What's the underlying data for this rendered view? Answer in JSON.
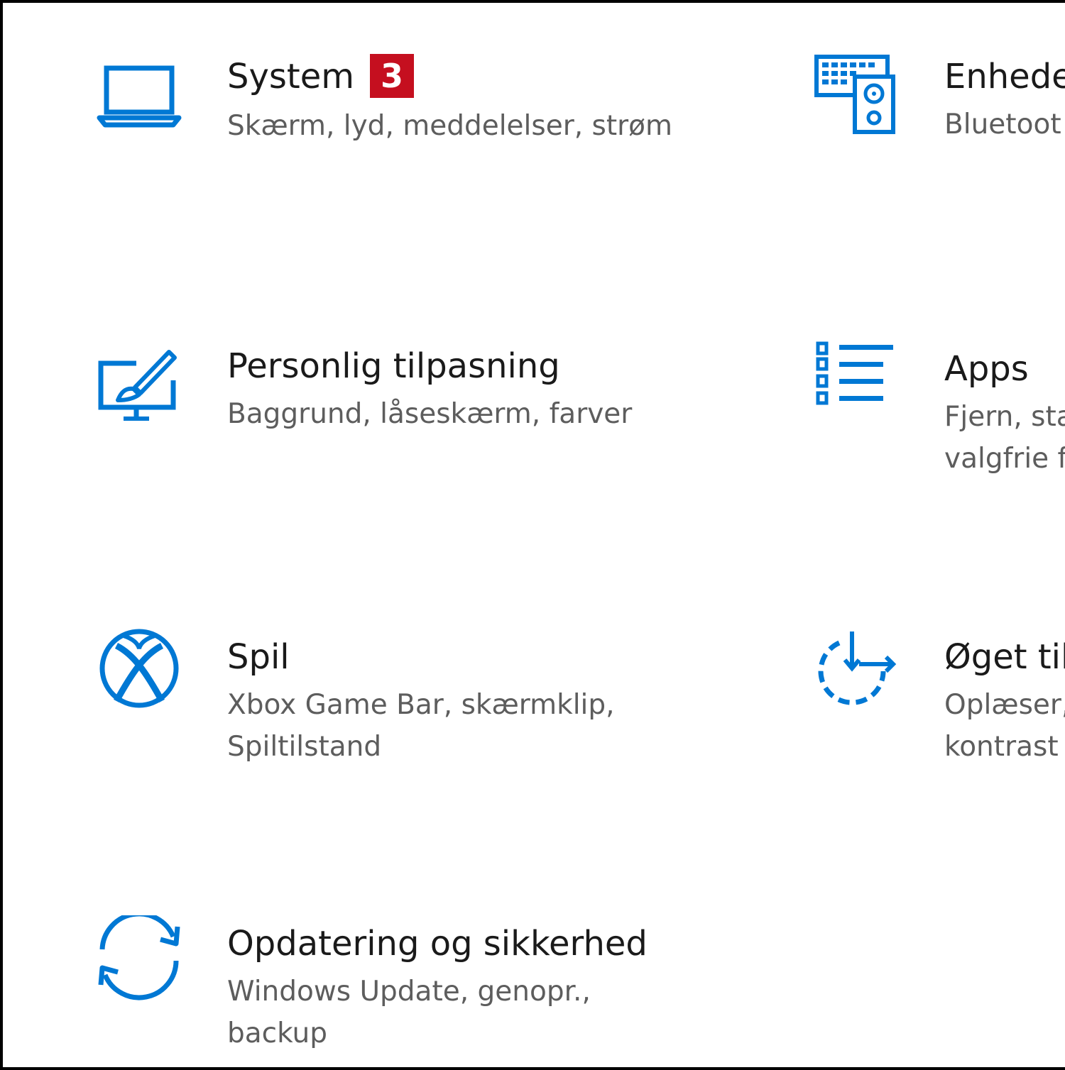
{
  "accent_color": "#0078d4",
  "badge_color": "#c50f1f",
  "tiles": [
    {
      "icon": "laptop-icon",
      "title": "System",
      "badge": "3",
      "desc_line1": "Skærm, lyd, meddelelser, strøm",
      "desc_line2": ""
    },
    {
      "icon": "keyboard-speaker-icon",
      "title": "Enhede",
      "desc_line1": "Bluetoot",
      "desc_line2": ""
    },
    {
      "icon": "monitor-paintbrush-icon",
      "title": "Personlig tilpasning",
      "desc_line1": "Baggrund, låseskærm, farver",
      "desc_line2": ""
    },
    {
      "icon": "apps-list-icon",
      "title": "Apps",
      "desc_line1": "Fjern, sta",
      "desc_line2": "valgfrie f"
    },
    {
      "icon": "xbox-icon",
      "title": "Spil",
      "desc_line1": "Xbox Game Bar, skærmklip,",
      "desc_line2": "Spiltilstand"
    },
    {
      "icon": "ease-of-access-icon",
      "title": "Øget til",
      "desc_line1": "Oplæser,",
      "desc_line2": "kontrast"
    },
    {
      "icon": "sync-arrows-icon",
      "title": "Opdatering og sikkerhed",
      "desc_line1": "Windows Update, genopr.,",
      "desc_line2": "backup"
    }
  ]
}
